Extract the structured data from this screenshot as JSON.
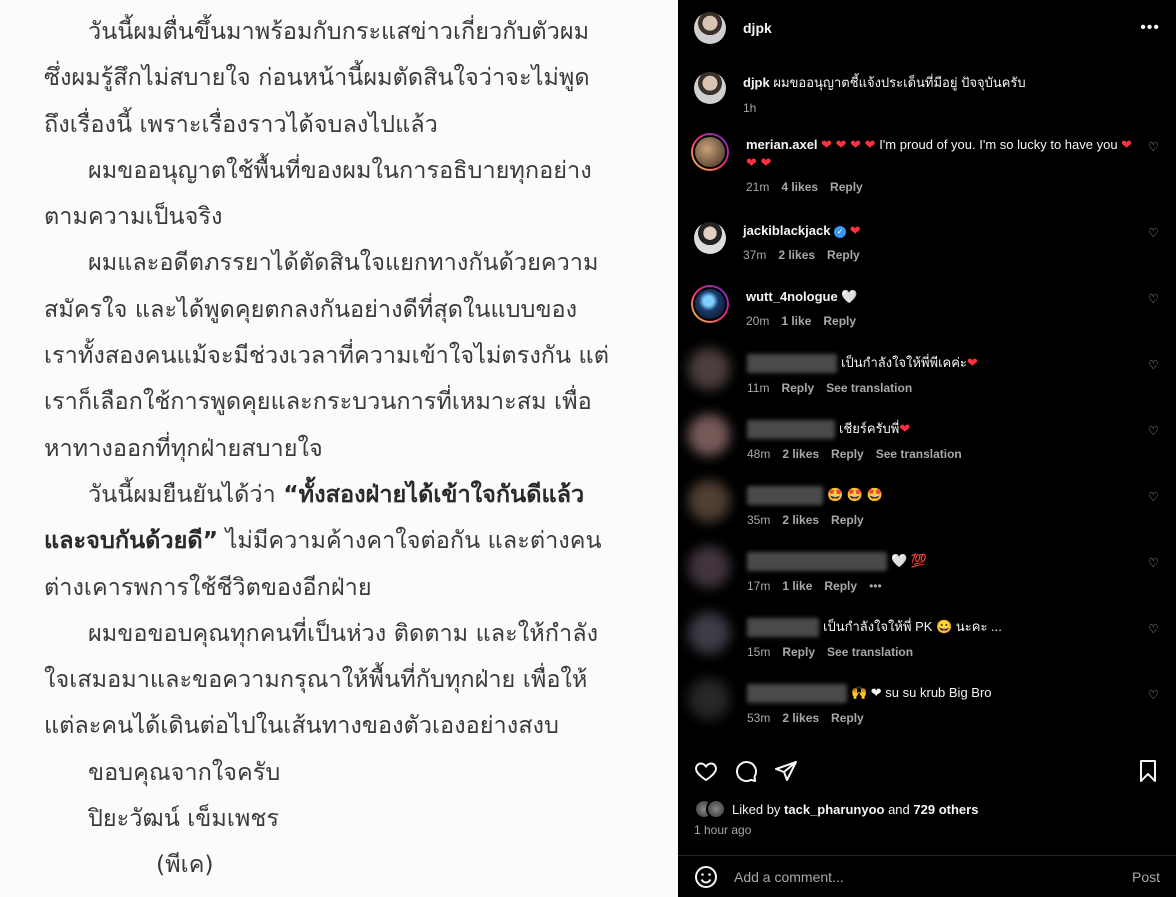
{
  "letter": {
    "lines": [
      "วันนี้ผมตื่นขึ้นมาพร้อมกับกระแสข่าวเกี่ยวกับตัวผม",
      "ซึ่งผมรู้สึกไม่สบายใจ ก่อนหน้านี้ผมตัดสินใจว่าจะไม่พูด",
      "ถึงเรื่องนี้ เพราะเรื่องราวได้จบลงไปแล้ว",
      "ผมขออนุญาตใช้พื้นที่ของผมในการอธิบายทุกอย่าง",
      "ตามความเป็นจริง",
      "ผมและอดีตภรรยาได้ตัดสินใจแยกทางกันด้วยความ",
      "สมัครใจ และได้พูดคุยตกลงกันอย่างดีที่สุดในแบบของ",
      "เราทั้งสองคนแม้จะมีช่วงเวลาที่ความเข้าใจไม่ตรงกัน แต่",
      "เราก็เลือกใช้การพูดคุยและกระบวนการที่เหมาะสม เพื่อ",
      "หาทางออกที่ทุกฝ่ายสบายใจ",
      "วันนี้ผมยืนยันได้ว่า",
      "“ทั้งสองฝ่ายได้เข้าใจกันดีแล้ว",
      "และจบกันด้วยดี”",
      " ไม่มีความค้างคาใจต่อกัน และต่างคน",
      "ต่างเคารพการใช้ชีวิตของอีกฝ่าย",
      "ผมขอขอบคุณทุกคนที่เป็นห่วง ติดตาม และให้กำลัง",
      "ใจเสมอมาและขอความกรุณาให้พื้นที่กับทุกฝ่าย เพื่อให้",
      "แต่ละคนได้เดินต่อไปในเส้นทางของตัวเองอย่างสงบ",
      "ขอบคุณจากใจครับ",
      "ปิยะวัฒน์ เข็มเพชร",
      "(พีเค)"
    ]
  },
  "post": {
    "username": "djpk",
    "more_icon": "more-horizontal-icon",
    "caption_user": "djpk",
    "caption_text": "ผมขออนุญาตชี้แจ้งประเด็นที่มีอยู่ ปัจจุบันครับ",
    "caption_time": "1h"
  },
  "comments": [
    {
      "user": "merian.axel",
      "text_before": "❤ ❤ ❤ ❤",
      "text": " I'm proud of you. I'm so lucky to have you ",
      "text_after": "❤ ❤ ❤",
      "time": "21m",
      "likes": "4 likes",
      "reply": "Reply"
    },
    {
      "user": "jackiblackjack",
      "verified": "✓",
      "text_after": "❤",
      "time": "37m",
      "likes": "2 likes",
      "reply": "Reply"
    },
    {
      "user": "wutt_4nologue",
      "text": " 🤍",
      "time": "20m",
      "likes": "1 like",
      "reply": "Reply"
    },
    {
      "text": "เป็นกำลังใจให้พี่พีเคค่ะ",
      "text_after": "❤",
      "time": "11m",
      "reply": "Reply",
      "translate": "See translation"
    },
    {
      "text": "เชียร์ครับพี่",
      "text_after": "❤",
      "time": "48m",
      "likes": "2 likes",
      "reply": "Reply",
      "translate": "See translation"
    },
    {
      "text": "🤩 🤩 🤩",
      "time": "35m",
      "likes": "2 likes",
      "reply": "Reply"
    },
    {
      "text": "🤍 💯",
      "time": "17m",
      "likes": "1 like",
      "reply": "Reply",
      "more": "•••"
    },
    {
      "text": "เป็นกำลังใจให้พี่ PK 😀 นะคะ ...",
      "time": "15m",
      "reply": "Reply",
      "translate": "See translation"
    },
    {
      "text": "🙌 ❤ su su krub Big Bro",
      "time": "53m",
      "likes": "2 likes",
      "reply": "Reply"
    }
  ],
  "likes": {
    "prefix": "Liked by ",
    "user": "tack_pharunyoo",
    "middle": " and ",
    "others": "729 others",
    "ago": "1 hour ago"
  },
  "add_comment": {
    "placeholder": "Add a comment...",
    "post_label": "Post"
  },
  "colors": {
    "panel_bg": "#000000",
    "secondary_text": "#a8a8a8",
    "heart_red": "#ff3040",
    "verified_blue": "#3897f0"
  }
}
